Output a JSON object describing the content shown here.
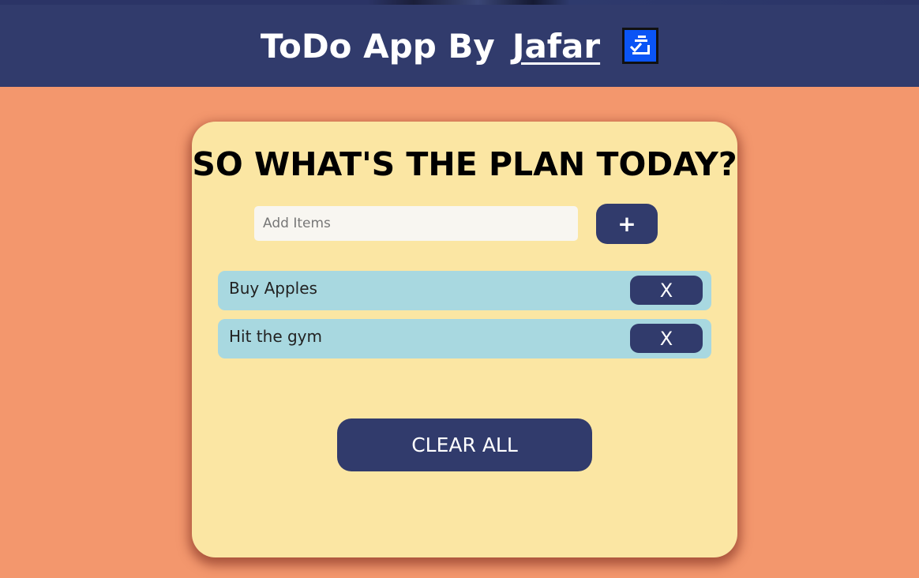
{
  "header": {
    "title": "ToDo App By",
    "author": "Jafar",
    "logo_icon": "checklist-icon"
  },
  "card": {
    "heading": "SO WHAT'S THE PLAN TODAY?",
    "input": {
      "value": "",
      "placeholder": "Add Items"
    },
    "add_button_label": "+",
    "items": [
      {
        "text": "Buy Apples",
        "delete_label": "X"
      },
      {
        "text": "Hit the gym",
        "delete_label": "X"
      }
    ],
    "clear_all_label": "CLEAR ALL"
  },
  "colors": {
    "page_background": "#f3976d",
    "header_background": "#313b6c",
    "card_background": "#fbe6a3",
    "item_background": "#a8d8e0",
    "button_background": "#313b6c",
    "logo_background": "#0a54f5"
  }
}
